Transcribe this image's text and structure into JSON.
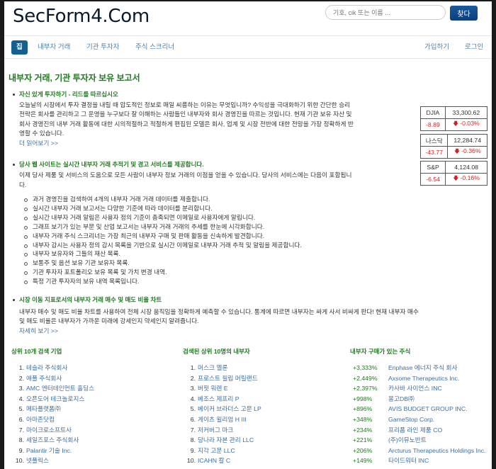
{
  "header": {
    "logo": "SecForm4.Com",
    "search_placeholder": "기호, cik 또는 이름 ...",
    "search_button": "찾다"
  },
  "nav": {
    "items": [
      {
        "label": "집",
        "active": true
      },
      {
        "label": "내부자 거래",
        "active": false
      },
      {
        "label": "기관 투자자",
        "active": false
      },
      {
        "label": "주식 스크리너",
        "active": false
      }
    ],
    "right": [
      "가입하기",
      "로그인"
    ]
  },
  "main": {
    "title": "내부자 거래, 기관 투자자 보유 보고서",
    "sections": [
      {
        "title": "자신 있게 투자하기 - 리드를 따르십시오",
        "lines": [
          "오늘날의 시장에서 투자 결정을 내릴 때 압도적인 정보로 매일 씨름하는 이유는 무엇입니까? 수익성을 극대화하기 위한 간단한 승리",
          "전략은 회사를 관리하고 그 운영을 누구보다 잘 이해하는 사람들인 내부자와 회사 경영진을 따르는 것입니다. 현재 기관 보유 자산 및",
          "회사 경영진의 내부 거래 활동에 대한 시의적절하고 적절하게 편집된 모델은 회사, 업계 및 시장 전반에 대한 전망을 가장 정확하게 반",
          "영할 수 있습니다."
        ],
        "link": "더 읽어보기 >>"
      },
      {
        "title": "당사 웹 사이트는 실시간 내부자 거래 추적기 및 경고 서비스를 제공합니다.",
        "lines": [
          "이제 당사 제품 및 서비스의 도움으로 모든 사람이 내부자 정보 거래의 이점을 얻을 수 있습니다. 당사의 서비스에는 다음이 포함됩니",
          "다."
        ],
        "items": [
          "과거 경영진을 검색하여 4개의 내부자 거래 거래 데이터를 제출합니다.",
          "실시간 내부자 거래 보고서는 다양한 기준에 따라 데이터를 분리합니다.",
          "실시간 내부자 거래 알림은 사용자 정의 기준이 충족되면 이메일로 사용자에게 알립니다.",
          "그래프 보기가 있는 부문 및 산업 보고서는 내부자 거래 거래의 추세를 한눈에 시각화합니다.",
          "내부자 거래 주식 스크리너는 가장 최근의 내부자 구매 및 판매 활동을 신속하게 발견합니다.",
          "내부자 감시는 사용자 정의 감시 목록을 기반으로 실시간 이메일로 내부자 거래 추적 및 알림을 제공합니다.",
          "내부자 보유자와 그들의 재산 목록.",
          "보통주 및 옵션 보유 기관 보유자 목록.",
          "기관 투자자 포트폴리오 보유 목록 및 가치 변경 내역.",
          "특정 기관 투자자의 보유 내역 목록입니다."
        ]
      },
      {
        "title": "시장 이동 지표로서의 내부자 거래 매수 및 매도 비율 차트",
        "lines": [
          "내부자 매수 및 매도 비율 차트를 사용하여 전체 시장 움직임을 정확하게 예측할 수 있습니다. 통계에 따르면 내부자는 싸게 사서 비싸게 판다! 현재 내부자 매수",
          "및 매도 비율은 내부자가 가까운 미래에 강세인지 약세인지 알려줍니다."
        ],
        "link": "자세히 보기 >>"
      }
    ]
  },
  "indices": [
    {
      "name": "DJIA",
      "value": "33,300.62",
      "change": "-8.89",
      "pct": "-0.03%",
      "direction": "down"
    },
    {
      "name": "나스닥",
      "value": "12,284.74",
      "change": "-43.77",
      "pct": "-0.36%",
      "direction": "down"
    },
    {
      "name": "S&P",
      "value": "4,124.08",
      "change": "-6.54",
      "pct": "-0.16%",
      "direction": "down"
    }
  ],
  "top_companies": {
    "title": "상위 10개 검색 기업",
    "items": [
      "테슬라 주식회사",
      "애플 주식회사",
      "AMC 엔터테인먼트 홀딩스",
      "오픈도어 테크놀로지스",
      "메타플랫폼㈜",
      "아마존닷컴",
      "마이크로소프트사",
      "세일즈포스 주식회사",
      "Palantir 기술 Inc.",
      "넷플릭스"
    ]
  },
  "top_insiders": {
    "title": "검색된 상위 10명의 내부자",
    "items": [
      "머스크 엘론",
      "프로스트 필립 머릴랜드",
      "버핏 워렌 E",
      "베조스 제프리 P",
      "베이커 브라더스 고문 LP",
      "게이츠 윌리엄 H III",
      "저커버그 마크",
      "당나라 자본 관리 LLC",
      "지각 고문 LLC",
      "ICAHN 칼 C"
    ]
  },
  "insider_buys": {
    "title": "내부자 구매가 있는 주식",
    "items": [
      {
        "pct": "+3,333%",
        "name": "Enphase 에너지 주식 회사"
      },
      {
        "pct": "+2,449%",
        "name": "Axsome Therapeutics Inc."
      },
      {
        "pct": "+2,397%",
        "name": "카사바 사이언스 INC"
      },
      {
        "pct": "+998%",
        "name": "몽고DB㈜"
      },
      {
        "pct": "+896%",
        "name": "AVIS BUDGET GROUP INC."
      },
      {
        "pct": "+348%",
        "name": "GameStop Corp."
      },
      {
        "pct": "+234%",
        "name": "프리폼 라인 제품 CO"
      },
      {
        "pct": "+221%",
        "name": "(주)이뮤노반트"
      },
      {
        "pct": "+206%",
        "name": "Arcturus Therapeutics Holdings Inc."
      },
      {
        "pct": "+149%",
        "name": "타이드워터 INC"
      }
    ]
  }
}
